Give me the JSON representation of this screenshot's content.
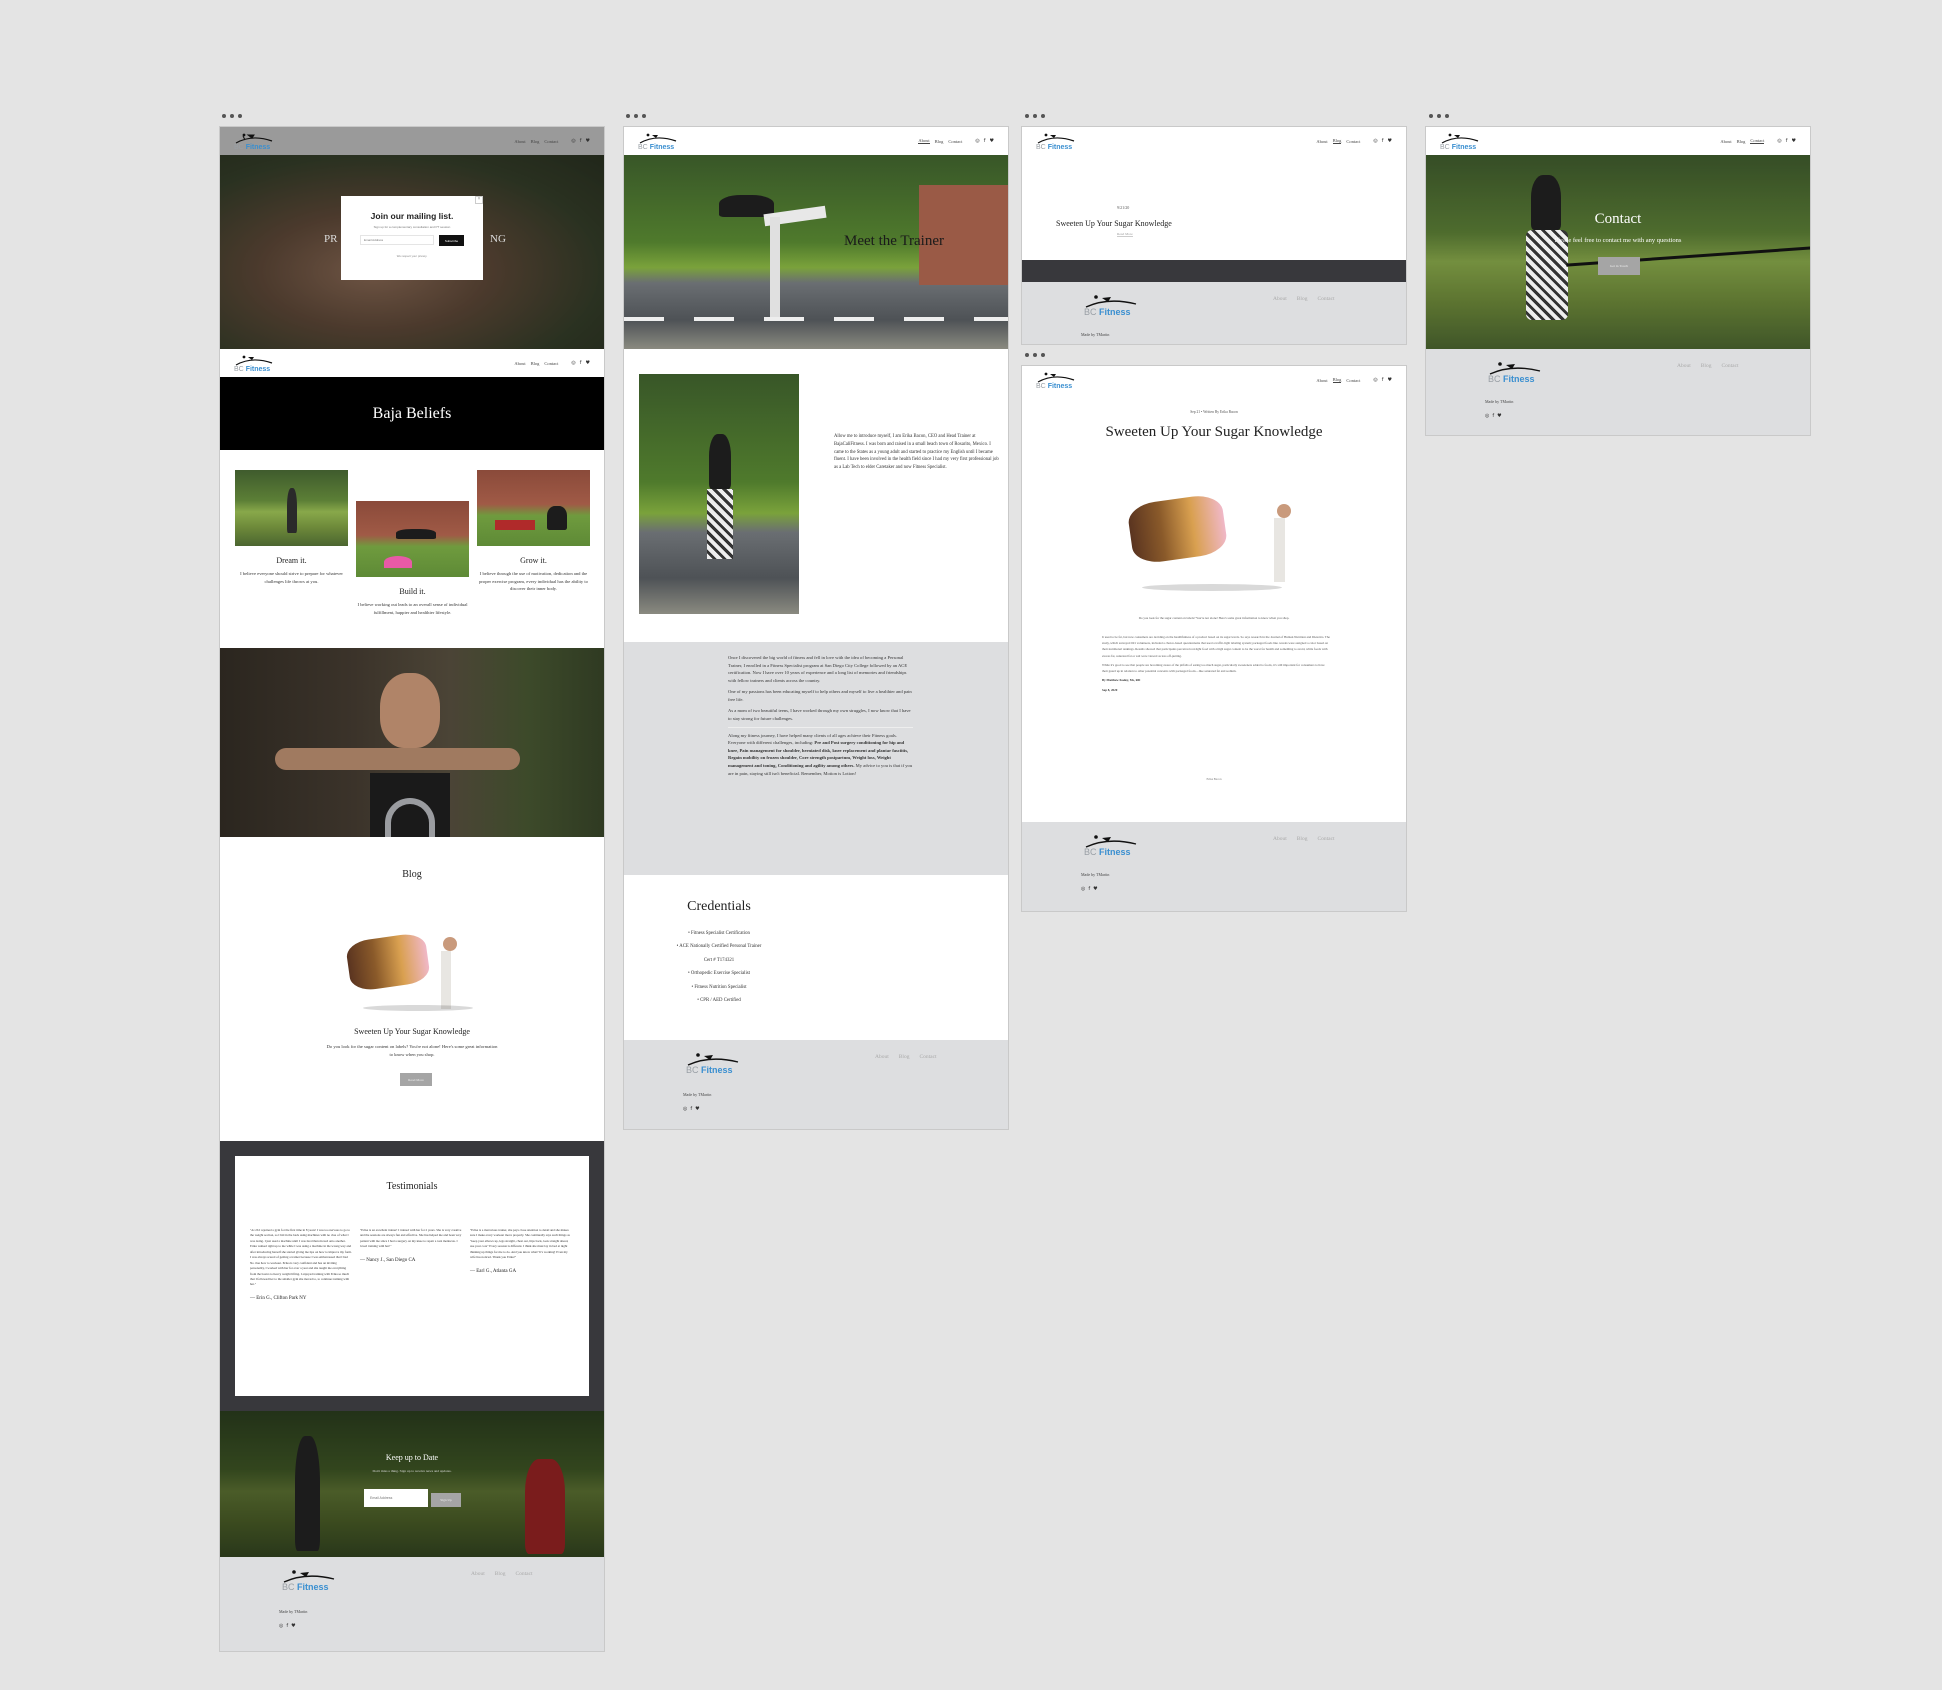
{
  "brand": {
    "logo_bc": "BC",
    "logo_fitness": "Fitness",
    "accent": "#3a8fd0"
  },
  "nav": {
    "about": "About",
    "blog": "Blog",
    "contact": "Contact"
  },
  "social_icons": [
    "instagram-icon",
    "facebook-icon",
    "twitter-icon"
  ],
  "footer": {
    "made_by": "Made by TMartin",
    "links": [
      "About",
      "Blog",
      "Contact"
    ]
  },
  "home": {
    "hero_left": "PR",
    "hero_right": "NG",
    "popup": {
      "title": "Join our mailing list.",
      "subtitle": "Sign up for a complementary consultation and PT session",
      "email_placeholder": "Email Address",
      "button": "Subscribe",
      "privacy": "We respect your privacy.",
      "close": "×"
    },
    "beliefs_title": "Baja Beliefs",
    "beliefs": [
      {
        "title": "Dream it.",
        "text": "I believe everyone should strive to prepare for whatever challenges life throws at you."
      },
      {
        "title": "Build it.",
        "text": "I believe working out leads to an overall sense of individual fulfillment, happier and  healthier lifestyle."
      },
      {
        "title": "Grow it.",
        "text": "I believe through the use of motivation, dedication and the proper exercise program, every individual has the ability to discover their inner body."
      }
    ],
    "blog_heading": "Blog",
    "blog_post_title": "Sweeten Up Your Sugar Knowledge",
    "blog_post_excerpt": "Do you look for the sugar content on labels?  You're not alone! Here's some great information to know when you shop.",
    "blog_read_more": "Read More",
    "testimonials_title": "Testimonials",
    "testimonials": [
      {
        "quote": "\"At 26 I rejoined a gym for the first time in 8 years! I was too nervous to go to the weight section, so I hid in the back using machines with no clue of what I was doing. I just used a machine until I was tired then moved onto another. Erika walked right up to me while I was using a machine in the wrong way and after introducing herself she started giving me tips on how to improve my form. I was always scared of getting a trainer because I was embarrassed that I had No clue how to workout. Erika is very confident and has an inviting personality, I worked with her for over a year and she taught me everything from the basics to heavy weight lifting. I enjoyed training with Erika so much that I followed her to the smaller gym she moved to, to continue training with her.\"",
        "author": "— Erin G., Clifton Park NY"
      },
      {
        "quote": "\"Erika is an excellent trainer! I trained with her for 2 years. She is very creative and the sessions are always fun and effective. She has helped me and been very patient with me since I had a surgery on my knee to repair a torn meniscus. I loved training with her!\"",
        "author": "— Nancy J., San Diego CA"
      },
      {
        "quote": "\"Erika is a marvelous trainer, she pays close attention to detail and she makes sure I make every workout move properly. She continually says such things as \"keep your elbows up, legs straight, chest out, hips back, look straight ahead, use your core\" Every session is different. I think she must lay in bed at night thinking up things for me to do. And you know what? It's working! Even my wife has noticed. Thank you Erika!\"",
        "author": "— Earl G., Atlanta GA"
      }
    ],
    "newsletter_title": "Keep up to Date",
    "newsletter_subtitle": "Don't miss a thing. Sign up to receive news and updates.",
    "newsletter_placeholder": "Email Address",
    "newsletter_button": "Sign Up"
  },
  "about": {
    "hero_title": "Meet the Trainer",
    "intro": "Allow me to introduce myself, I am Erika Bacon, CEO and Head Trainer at BajaCaliFitness.  I was born and raised in a small beach town of Rosarito, Mexico. I came to the States as a young adult and started to practice my English until I became fluent.  I have been involved in the health field since I had my very first professional  job as a Lab Tech to elder Caretaker and now Fitness Specialist.",
    "story_p1": "Once I discovered the big world of fitness and fell in love with the idea of becoming a Personal Trainer, I enrolled in a Fitness Specialist program at San Diego City College followed by an ACE certification.  Now I have over 10 years of experience and a long list of memories and friendships with fellow trainers and clients across the country.",
    "story_p2": "One of my passions has been educating myself to help others and myself to live a healthier and pain free life.",
    "story_p3": "As a mom of two beautiful teens, I have worked through my own struggles, I now know that I have to stay strong for future challenges.",
    "story_p4_intro": "Along my fitness journey, I have helped many clients of all ages achieve their Fitness goals.  Everyone with different challenges, including: ",
    "story_p4_bold": "Pre and Post surgery conditioning for hip and knee, Pain management for shoulder, herniated disk, knee replacement and plantar fasciitis, Regain mobility on frozen shoulder, Core strength postpartum, Weight loss, Weight management and toning, Conditioning and agility among others.",
    "story_p4_end": " My advice to you is that if you are in pain, staying still isn't beneficial. Remember, Motion is Lotion!",
    "credentials_title": "Credentials",
    "credentials": [
      "• Fitness Specialist Certification",
      "• ACE Nationally Certified Personal Trainer",
      "Cert # T174321",
      "• Orthopedic Exercise Specialist",
      "• Fitness Nutrition Specialist",
      "• CPR / AED Certified"
    ]
  },
  "blog_list": {
    "date": "9/21/20",
    "title": "Sweeten Up Your Sugar Knowledge",
    "read_more": "Read More"
  },
  "blog_post": {
    "meta": "Sep 21  •  Written By Erika Bacon",
    "title": "Sweeten Up Your Sugar Knowledge",
    "intro": "Do you look for the sugar content on labels?  You're not alone! Here's some great information to know when you shop.",
    "p1": "It used to be fat, but now consumers are deciding on the healthfulness of a product based on its sugar levels. So says research in the Journal of Human Nutrition and Dietetics. The study, which surveyed 691 volunteers, included a choice-based questionnaire that used a traffic-light labeling system; packaged foods like cereals were assigned a color based on their nutritional rankings. Results showed that participants perceived red-light food with a high sugar content to be the worst for health and something to avoid, while foods with excess fat, saturated fat or salt were viewed as less off-putting.",
    "p2": "While it's good to see that people are becoming aware of the pitfalls of eating too much sugar, particularly sweeteners added to foods, it's still important for consumers to have their guard up in relation to other potential concerns with packaged foods—like saturated fat and sodium.",
    "byline": "By Matthew Kadey, Ms, RD",
    "date": "Sep 8, 2020",
    "author_tag": "Erika Bacon"
  },
  "contact": {
    "title": "Contact",
    "subtitle": "Please feel free to contact me with any questions",
    "button": "Get in Touch"
  }
}
